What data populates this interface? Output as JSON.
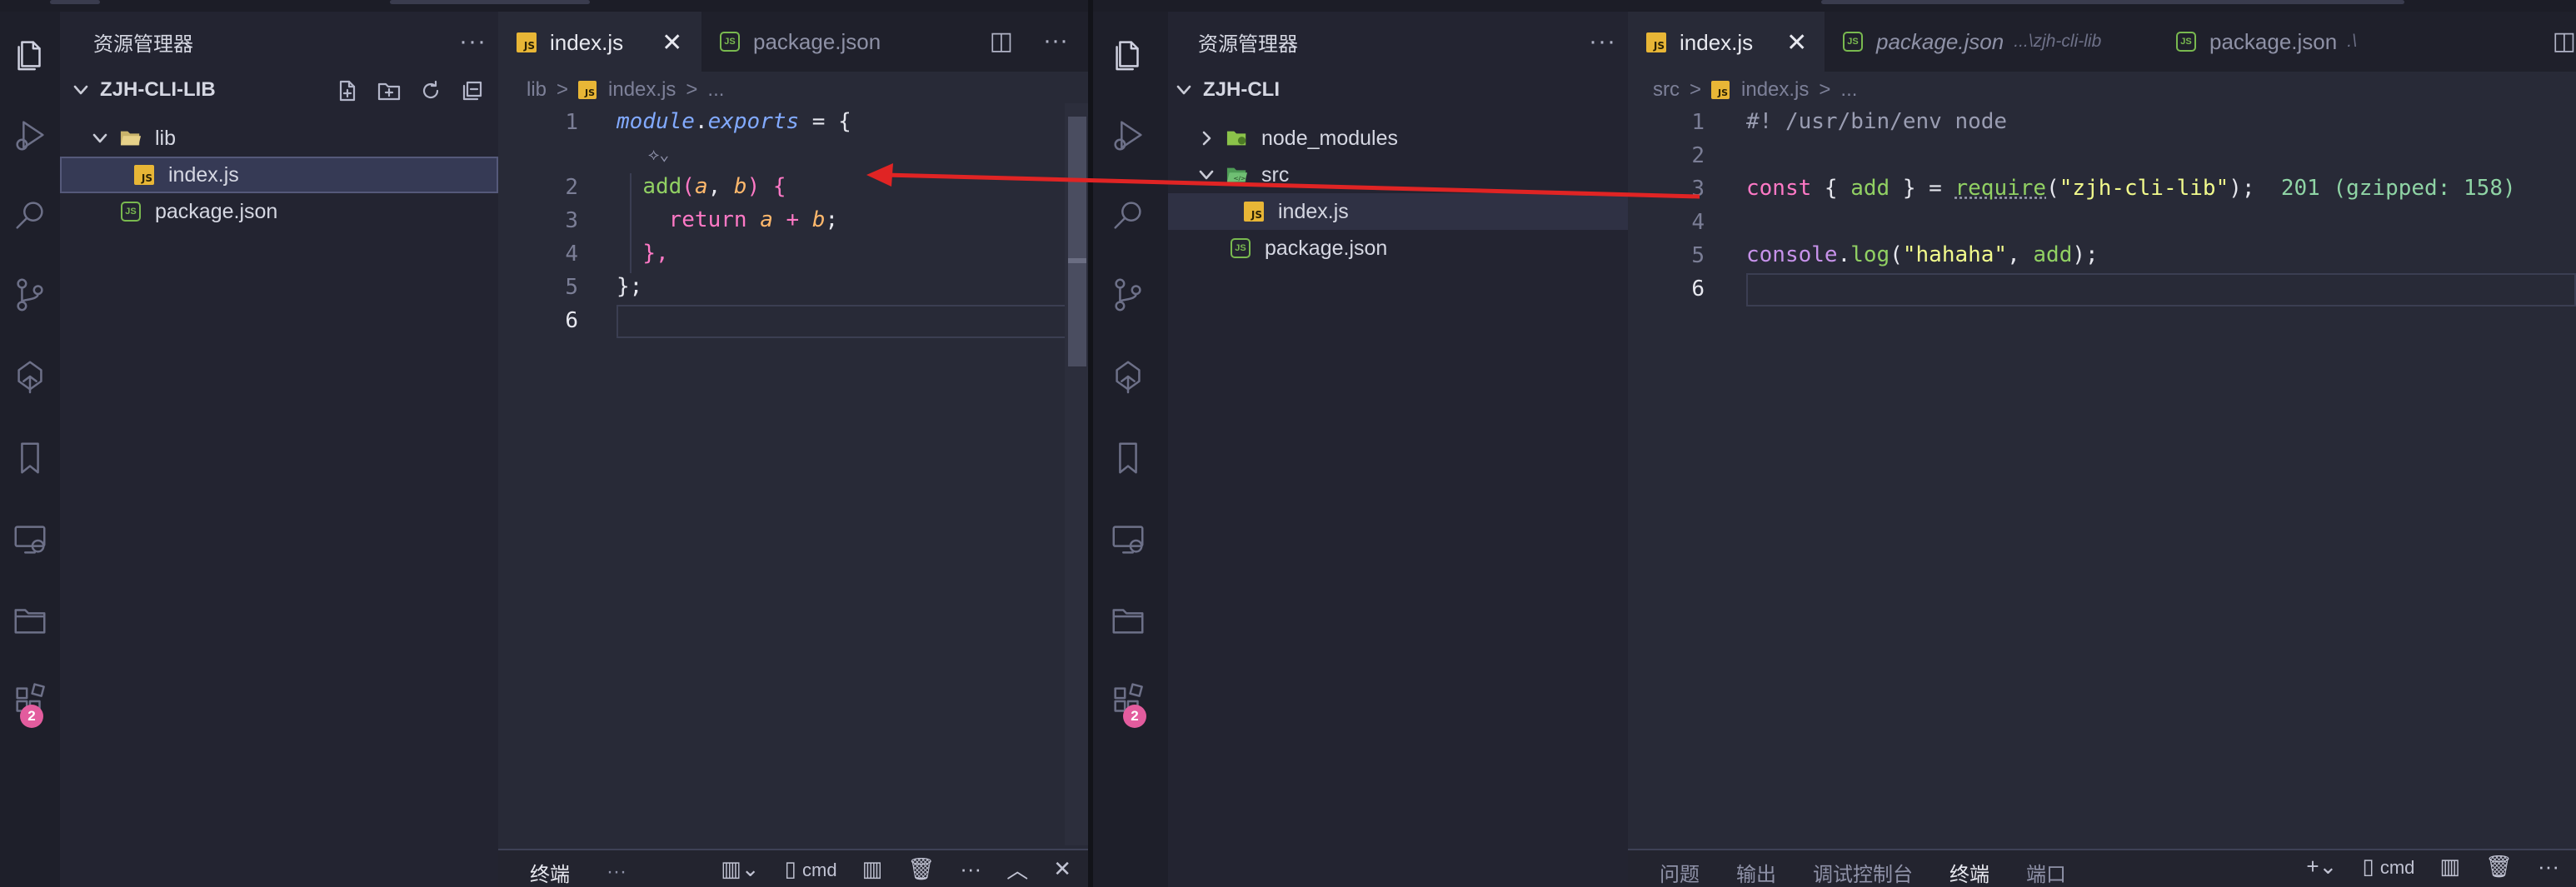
{
  "left": {
    "sidebar": {
      "title": "资源管理器",
      "more": "···",
      "project": "ZJH-CLI-LIB",
      "tree": [
        {
          "name": "lib",
          "type": "folder",
          "open": true
        },
        {
          "name": "index.js",
          "type": "js",
          "selected": true
        },
        {
          "name": "package.json",
          "type": "json"
        }
      ]
    },
    "tabs": [
      {
        "label": "index.js",
        "active": true,
        "close": "✕"
      },
      {
        "label": "package.json",
        "active": false
      }
    ],
    "tab_actions": [
      "◫",
      "···"
    ],
    "breadcrumb": [
      "lib",
      "index.js",
      "..."
    ],
    "line_numbers": [
      "1",
      "2",
      "3",
      "4",
      "5",
      "6"
    ],
    "panel": {
      "tab": "终端",
      "more": "···",
      "shell": "cmd"
    },
    "activity_badge": "2"
  },
  "right": {
    "sidebar": {
      "title": "资源管理器",
      "more": "···",
      "project": "ZJH-CLI",
      "tree": [
        {
          "name": "node_modules",
          "type": "folder",
          "open": false
        },
        {
          "name": "src",
          "type": "folder",
          "open": true
        },
        {
          "name": "index.js",
          "type": "js",
          "selected": true
        },
        {
          "name": "package.json",
          "type": "json"
        }
      ]
    },
    "tabs": [
      {
        "label": "index.js",
        "active": true,
        "close": "✕"
      },
      {
        "label": "package.json",
        "desc": "...\\zjh-cli-lib",
        "active": false
      },
      {
        "label": "package.json",
        "desc": ".\\",
        "active": false
      }
    ],
    "breadcrumb": [
      "src",
      "index.js",
      "..."
    ],
    "line_numbers": [
      "1",
      "2",
      "3",
      "4",
      "5",
      "6"
    ],
    "import_cost": "201 (gzipped: 158)",
    "panel": {
      "tabs": [
        "问题",
        "输出",
        "调试控制台",
        "终端",
        "端口"
      ],
      "active": "终端",
      "shell": "cmd",
      "more": "···"
    },
    "activity_badge": "2"
  },
  "code_left": {
    "l1_a": "module",
    "l1_b": ".",
    "l1_c": "exports",
    "l1_d": " = {",
    "l2_a": "add",
    "l2_b": "(",
    "l2_c": "a",
    "l2_d": ", ",
    "l2_e": "b",
    "l2_f": ") {",
    "l3_a": "return ",
    "l3_b": "a",
    "l3_c": " + ",
    "l3_d": "b",
    "l3_e": ";",
    "l4": "},",
    "l5": "};"
  },
  "code_right": {
    "l1": "#! /usr/bin/env node",
    "l3_a": "const",
    "l3_b": " { ",
    "l3_c": "add",
    "l3_d": " } = ",
    "l3_e": "require",
    "l3_f": "(",
    "l3_g": "\"zjh-cli-lib\"",
    "l3_h": ");",
    "l5_a": "console",
    "l5_b": ".",
    "l5_c": "log",
    "l5_d": "(",
    "l5_e": "\"hahaha\"",
    "l5_f": ", ",
    "l5_g": "add",
    "l5_h": ");"
  },
  "colors": {
    "arrow": "#e02424",
    "badge": "#e35c9e",
    "selected_row": "#363a55"
  }
}
